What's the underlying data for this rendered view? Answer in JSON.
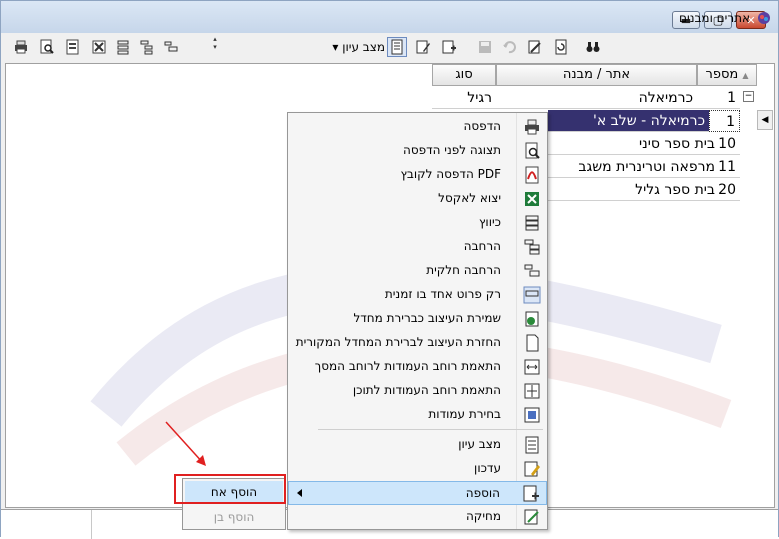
{
  "window": {
    "title": "אתרים ומבנים",
    "min_label": "▬",
    "max_label": "▢",
    "close_label": "✕"
  },
  "toolbar": {
    "view_mode": "מצב עיון"
  },
  "grid": {
    "columns": [
      "מספר",
      "אתר / מבנה",
      "סוג"
    ],
    "rows": [
      {
        "num": "1",
        "site": "כרמיאלה",
        "type": "רגיל"
      },
      {
        "num": "1",
        "site": "כרמיאלה - שלב א'",
        "type": ""
      },
      {
        "num": "10",
        "site": "בית ספר סיני",
        "type": ""
      },
      {
        "num": "11",
        "site": "מרפאה וטרינרית משגב",
        "type": ""
      },
      {
        "num": "20",
        "site": "בית ספר גליל",
        "type": ""
      }
    ],
    "tree_toggle": "−",
    "sort_indicator": "▲"
  },
  "context_menu": {
    "items": [
      {
        "label": "הדפסה",
        "icon": "printer-icon"
      },
      {
        "label": "תצוגה לפני הדפסה",
        "icon": "print-preview-icon"
      },
      {
        "label": "PDF הדפסה לקובץ",
        "icon": "pdf-icon"
      },
      {
        "label": "יצוא לאקסל",
        "icon": "excel-icon"
      },
      {
        "label": "כיווץ",
        "icon": "collapse-icon"
      },
      {
        "label": "הרחבה",
        "icon": "expand-icon"
      },
      {
        "label": "הרחבה חלקית",
        "icon": "partial-expand-icon"
      },
      {
        "label": "רק פרוט אחד בו זמנית",
        "icon": "single-detail-icon"
      },
      {
        "label": "שמירת  העיצוב כברירת מחדל",
        "icon": "save-layout-icon"
      },
      {
        "label": "החזרת  העיצוב לברירת המחדל המקורית",
        "icon": "reset-layout-icon"
      },
      {
        "label": "התאמת רוחב העמודות לרוחב המסך",
        "icon": "fit-screen-icon"
      },
      {
        "label": "התאמת רוחב העמודות לתוכן",
        "icon": "fit-content-icon"
      },
      {
        "label": "בחירת עמודות",
        "icon": "choose-columns-icon"
      },
      {
        "label": "מצב עיון",
        "icon": "view-mode-icon"
      },
      {
        "label": "עדכון",
        "icon": "edit-icon"
      },
      {
        "label": "הוספה",
        "icon": "add-icon"
      },
      {
        "label": "מחיקה",
        "icon": "delete-icon"
      }
    ]
  },
  "submenu": {
    "add_sibling": "הוסף אח",
    "add_child": "הוסף בן"
  }
}
